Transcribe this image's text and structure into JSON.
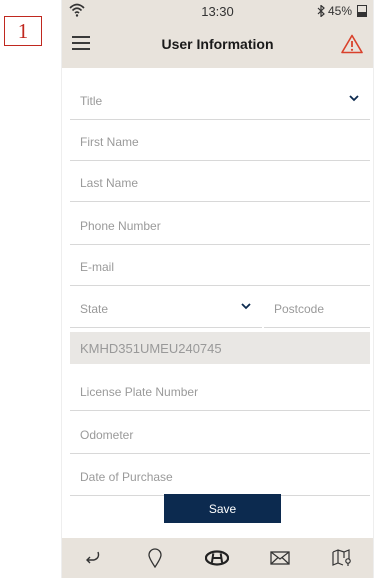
{
  "annotation": {
    "number": "1"
  },
  "status": {
    "time": "13:30",
    "battery": "45%"
  },
  "header": {
    "title": "User Information"
  },
  "form": {
    "title": {
      "placeholder": "Title"
    },
    "first_name": {
      "placeholder": "First Name"
    },
    "last_name": {
      "placeholder": "Last Name"
    },
    "phone": {
      "placeholder": "Phone Number"
    },
    "email": {
      "placeholder": "E-mail"
    },
    "state": {
      "placeholder": "State"
    },
    "postcode": {
      "placeholder": "Postcode"
    },
    "vin": {
      "value": "KMHD351UMEU240745"
    },
    "license_plate": {
      "placeholder": "License Plate Number"
    },
    "odometer": {
      "placeholder": "Odometer"
    },
    "date_of_purchase": {
      "placeholder": "Date of Purchase"
    }
  },
  "actions": {
    "save_label": "Save"
  },
  "tabbar": {
    "items": [
      {
        "icon": "back-arrow-icon"
      },
      {
        "icon": "location-pin-icon"
      },
      {
        "icon": "hyundai-logo-icon"
      },
      {
        "icon": "mail-icon"
      },
      {
        "icon": "map-icon"
      }
    ]
  },
  "colors": {
    "accent": "#0c2a4f",
    "header_bg": "#e8e3dc",
    "warning": "#d9412b",
    "annotation": "#c0281f"
  }
}
